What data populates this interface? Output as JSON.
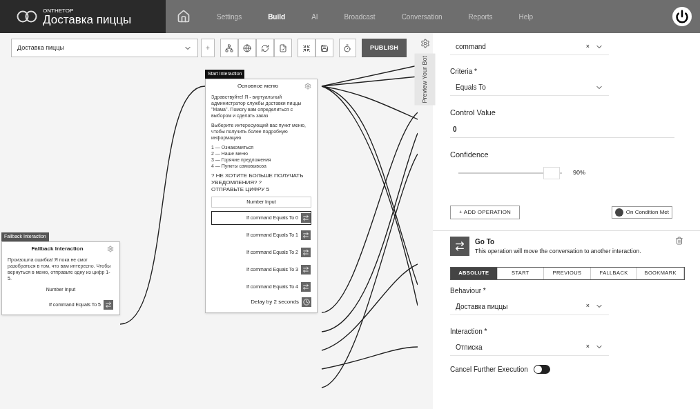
{
  "header": {
    "brand_small": "ONTHETOP",
    "brand": "Доставка пиццы",
    "nav": [
      {
        "label": "Settings",
        "selected": false
      },
      {
        "label": "Build",
        "selected": true
      },
      {
        "label": "AI",
        "selected": false
      },
      {
        "label": "Broadcast",
        "selected": false
      },
      {
        "label": "Conversation",
        "selected": false
      },
      {
        "label": "Reports",
        "selected": false
      },
      {
        "label": "Help",
        "selected": false
      }
    ]
  },
  "toolbar": {
    "bot_select": "Доставка пиццы",
    "add": "+",
    "publish": "PUBLISH"
  },
  "preview_tab": "Preview Your Bot",
  "nodes": [
    {
      "kind": "fallback",
      "tag": "Fallback Interaction",
      "title": "Fallback Interaction",
      "paragraphs": [
        "Произошла ошибка! Я пока не смог разобраться в том, что вам интересно. Чтобы вернуться в меню, отправьте одну из цифр 1-5."
      ],
      "input": "Number Input",
      "conditions": [
        {
          "text": "If command Equals To 5",
          "selected": false
        }
      ]
    },
    {
      "kind": "start",
      "tag": "Start Interaction",
      "title": "Основное меню",
      "paragraphs": [
        "Здравствуйте! Я - виртуальный администратор службы доставки пиццы \"Мама\". Помогу вам определиться с выбором и сделать заказ",
        "Выберите интересующий вас пункт меню, чтобы получить более подробную информацию"
      ],
      "list": [
        "1 — Ознакомиться",
        "2 — Наше меню",
        "3 — Горячие предложения",
        "4 — Пункты самовывоза"
      ],
      "notice": [
        "? НЕ ХОТИТЕ БОЛЬШЕ ПОЛУЧАТЬ УВЕДОМЛЕНИЯ? ?",
        "ОТПРАВЬТЕ ЦИФРУ 5"
      ],
      "input": "Number Input",
      "conditions": [
        {
          "text": "If command Equals To 0",
          "selected": true
        },
        {
          "text": "If command Equals To 1",
          "selected": false
        },
        {
          "text": "If command Equals To 2",
          "selected": false
        },
        {
          "text": "If command Equals To 3",
          "selected": false
        },
        {
          "text": "If command Equals To 4",
          "selected": false
        }
      ],
      "delay": "Delay by 2 seconds"
    }
  ],
  "panel": {
    "variable": {
      "value": "command",
      "clear": "×"
    },
    "criteria": {
      "label": "Criteria *",
      "value": "Equals To"
    },
    "control_value": {
      "label": "Control Value",
      "value": "0"
    },
    "confidence": {
      "label": "Confidence",
      "level": 0.9,
      "reading": "90%"
    },
    "add_operation": "+ ADD OPERATION",
    "condition_button": "On Condition Met",
    "goto": {
      "title": "Go To",
      "description": "This operation will move the conversation to another interaction.",
      "tabs": [
        {
          "label": "ABSOLUTE",
          "selected": true
        },
        {
          "label": "START",
          "selected": false
        },
        {
          "label": "PREVIOUS",
          "selected": false
        },
        {
          "label": "FALLBACK",
          "selected": false
        },
        {
          "label": "BOOKMARK",
          "selected": false
        }
      ],
      "behaviour": {
        "label": "Behaviour *",
        "value": "Доставка пиццы",
        "clear": "×"
      },
      "interaction": {
        "label": "Interaction *",
        "value": "Отписка",
        "clear": "×"
      },
      "cancel": {
        "label": "Cancel Further Execution",
        "on": false
      }
    }
  }
}
